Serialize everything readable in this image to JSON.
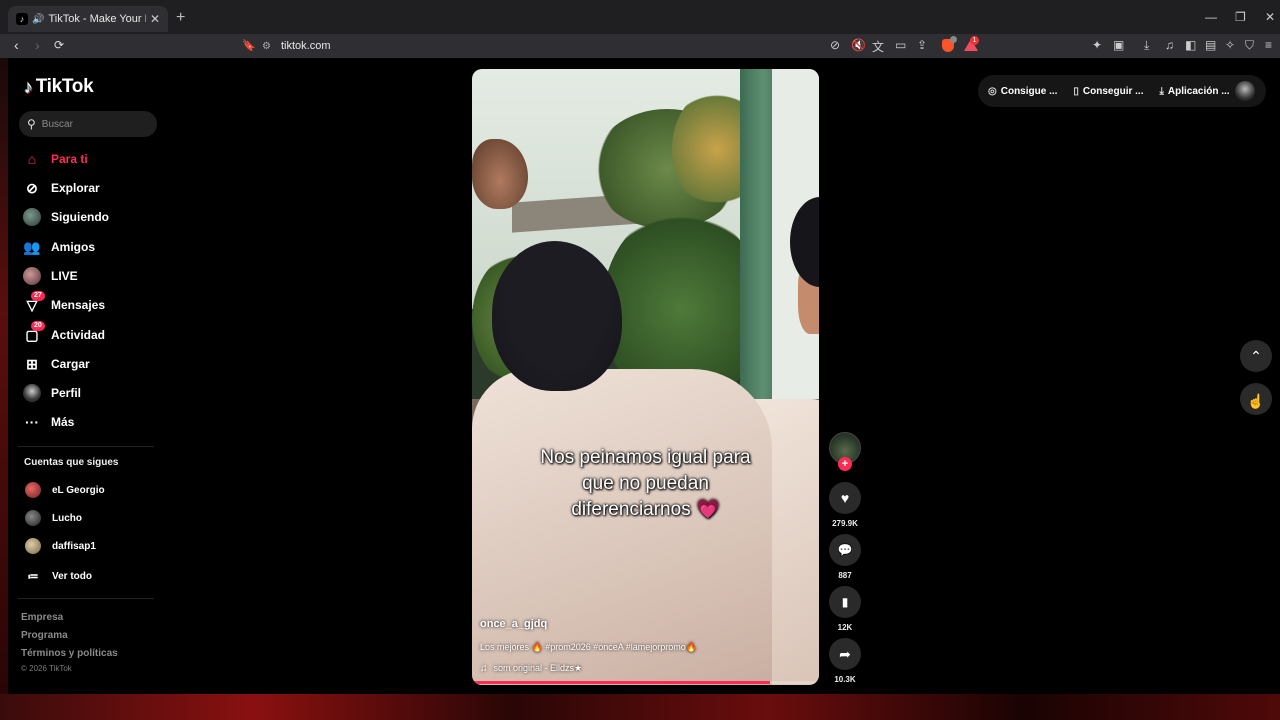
{
  "browser": {
    "tab_title": "TikTok - Make Your Day",
    "url": "tiktok.com",
    "new_tab": "+",
    "rewards_count": "1"
  },
  "sidebar": {
    "logo": "TikTok",
    "search_placeholder": "Buscar",
    "nav": [
      {
        "label": "Para ti",
        "icon": "home-icon",
        "active": true
      },
      {
        "label": "Explorar",
        "icon": "compass-icon"
      },
      {
        "label": "Siguiendo",
        "icon": "following-avatar-icon"
      },
      {
        "label": "Amigos",
        "icon": "friends-icon"
      },
      {
        "label": "LIVE",
        "icon": "live-icon"
      },
      {
        "label": "Mensajes",
        "icon": "messages-icon",
        "badge": "27"
      },
      {
        "label": "Actividad",
        "icon": "activity-icon",
        "badge": "20"
      },
      {
        "label": "Cargar",
        "icon": "upload-icon"
      },
      {
        "label": "Perfil",
        "icon": "profile-avatar-icon"
      },
      {
        "label": "Más",
        "icon": "more-icon"
      }
    ],
    "following_title": "Cuentas que sigues",
    "following": [
      {
        "name": "eL Georgio"
      },
      {
        "name": "Lucho"
      },
      {
        "name": "daffisap1"
      }
    ],
    "see_all": "Ver todo",
    "footer_links": [
      "Empresa",
      "Programa",
      "Términos y políticas"
    ],
    "copyright": "© 2026 TikTok"
  },
  "top_actions": [
    {
      "label": "Consigue ...",
      "icon": "coin-icon"
    },
    {
      "label": "Conseguir ...",
      "icon": "phone-icon"
    },
    {
      "label": "Aplicación ...",
      "icon": "download-icon"
    }
  ],
  "video": {
    "overlay_text_1": "Nos peinamos igual para",
    "overlay_text_2": "que no puedan",
    "overlay_text_3": "diferenciarnos",
    "overlay_emoji": "💗",
    "author": "once_a_gjdq",
    "description": "Los mejores 🔥 #prom2026 #onceA #lamejorpromo🔥",
    "sound": "som original - Elldzs★",
    "progress": 0.86
  },
  "actions": {
    "likes": "279.9K",
    "comments": "887",
    "saves": "12K",
    "shares": "10.3K"
  },
  "colors": {
    "accent": "#fe2c55",
    "background": "#000000"
  }
}
